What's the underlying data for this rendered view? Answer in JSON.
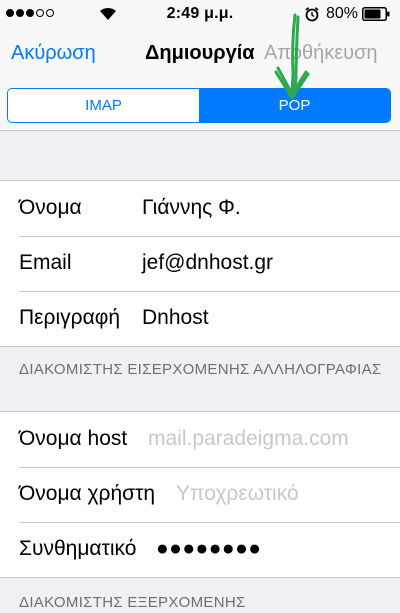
{
  "status_bar": {
    "signal_filled": 3,
    "signal_total": 5,
    "time": "2:49 μ.μ.",
    "battery_percent": "80%",
    "battery_level": 0.8
  },
  "nav": {
    "cancel_label": "Ακύρωση",
    "title": "Δημιουργία",
    "save_label": "Αποθήκευση"
  },
  "segments": {
    "items": [
      "IMAP",
      "POP"
    ],
    "selected": "POP"
  },
  "account": {
    "name_label": "Όνομα",
    "name_value": "Γιάννης Φ.",
    "email_label": "Email",
    "email_value": "jef@dnhost.gr",
    "description_label": "Περιγραφή",
    "description_value": "Dnhost"
  },
  "incoming": {
    "header": "ΔΙΑΚΟΜΙΣΤΗΣ ΕΙΣΕΡΧΟΜΕΝΗΣ ΑΛΛΗΛΟΓΡΑΦΙΑΣ",
    "host_label": "Όνομα host",
    "host_placeholder": "mail.paradeigma.com",
    "username_label": "Όνομα χρήστη",
    "username_placeholder": "Υποχρεωτικό",
    "password_label": "Συνθηματικό",
    "password_value": "●●●●●●●●"
  },
  "outgoing": {
    "header": "ΔΙΑΚΟΜΙΣΤΗΣ ΕΞΕΡΧΟΜΕΝΗΣ"
  },
  "colors": {
    "accent": "#007aff",
    "disabled": "#a6a6ab",
    "annotation": "#2ea84f"
  }
}
